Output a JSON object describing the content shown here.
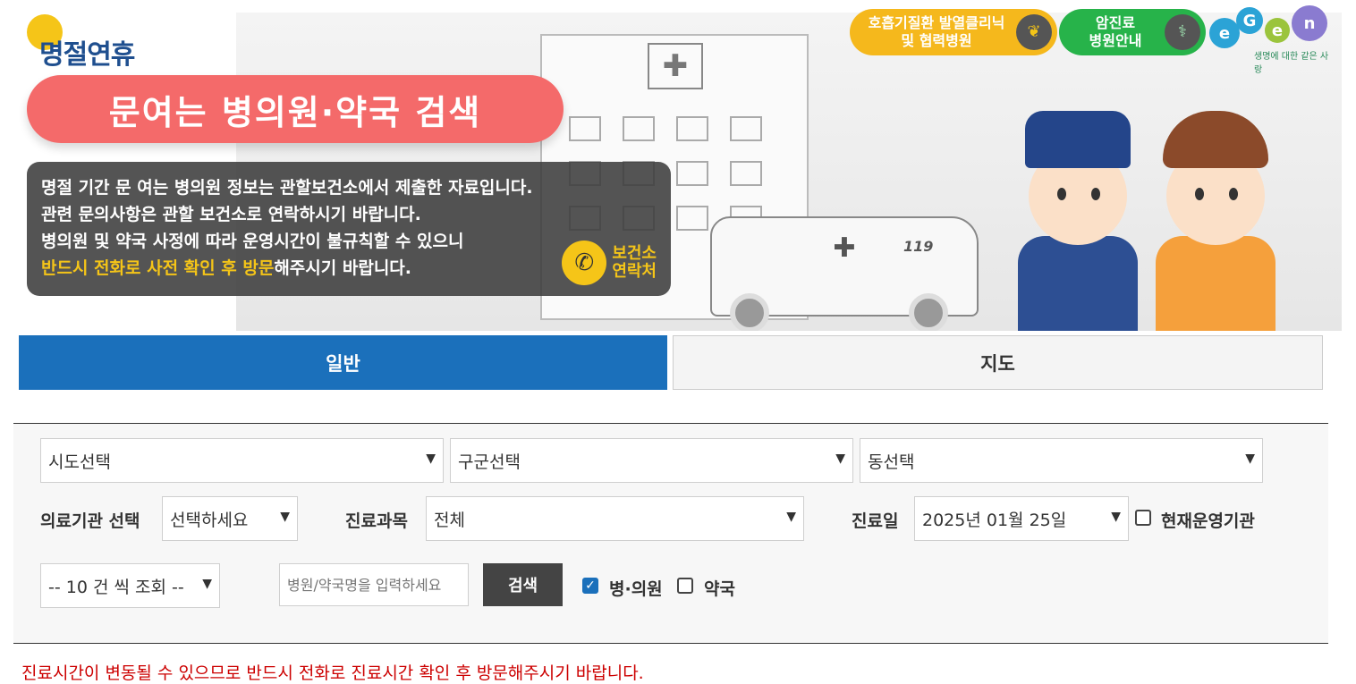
{
  "banner": {
    "logo_text": "명절연휴",
    "title": "문여는 병의원·약국 검색",
    "notice_lines": [
      "명절 기간 문 여는 병의원 정보는 관할보건소에서 제출한 자료입니다.",
      "관련 문의사항은 관할 보건소로 연락하시기 바랍니다.",
      "병의원 및 약국 사정에 따라 운영시간이 불규칙할 수 있으니"
    ],
    "notice_highlight": "반드시 전화로 사전 확인 후 방문",
    "notice_tail": "해주시기 바랍니다.",
    "contact_line1": "보건소",
    "contact_line2": "연락처",
    "fever_clinic_line1": "호흡기질환 발열클리닉",
    "fever_clinic_line2": "및 협력병원",
    "cancer_line1": "암진료",
    "cancer_line2": "병원안내",
    "egen_logo": "E-GEN",
    "egen_tagline": "생명에 대한 같은 사랑",
    "ambulance_text": "119"
  },
  "tabs": [
    {
      "label": "일반",
      "active": true
    },
    {
      "label": "지도",
      "active": false
    }
  ],
  "search": {
    "sido": "시도선택",
    "gugun": "구군선택",
    "dong": "동선택",
    "institution_label": "의료기관 선택",
    "institution_value": "선택하세요",
    "dept_label": "진료과목",
    "dept_value": "전체",
    "date_label": "진료일",
    "date_value": "2025년 01월 25일",
    "open_now_label": "현재운영기관",
    "page_size": "-- 10 건 씩 조회 --",
    "name_placeholder": "병원/약국명을 입력하세요",
    "search_button": "검색",
    "hospital_label": "병·의원",
    "hospital_checked": true,
    "pharmacy_label": "약국",
    "pharmacy_checked": false
  },
  "warning": "진료시간이 변동될 수 있으므로 반드시 전화로 진료시간 확인 후 방문해주시기 바랍니다.",
  "colors": {
    "tab_active": "#1b70bb",
    "title_pill": "#f46a6a",
    "highlight": "#f5c518",
    "warning": "#cc0000"
  }
}
